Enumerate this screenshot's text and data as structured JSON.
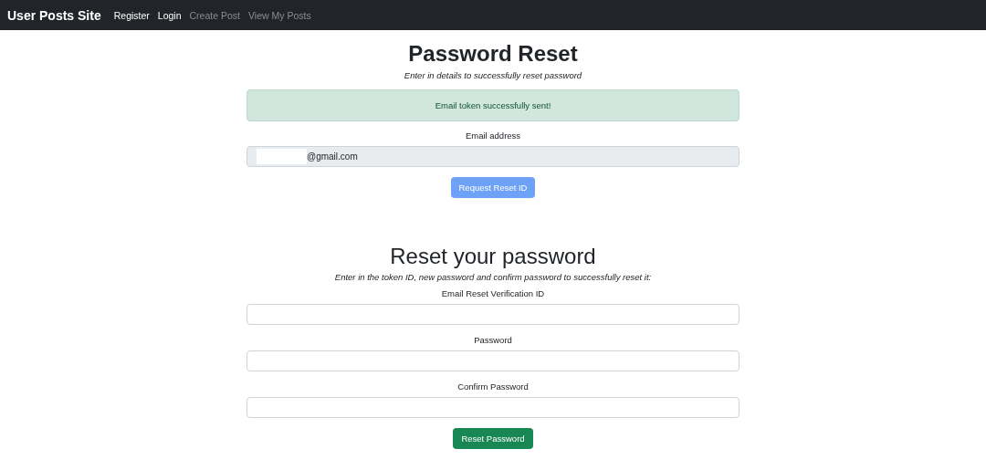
{
  "navbar": {
    "brand": "User Posts Site",
    "links": [
      {
        "label": "Register",
        "disabled": false
      },
      {
        "label": "Login",
        "disabled": false
      },
      {
        "label": "Create Post",
        "disabled": true
      },
      {
        "label": "View My Posts",
        "disabled": true
      }
    ]
  },
  "request_section": {
    "title": "Password Reset",
    "subtitle": "Enter in details to successfully reset password",
    "alert": "Email token successfully sent!",
    "email_label": "Email address",
    "email_value": "@gmail.com",
    "email_redacted": true,
    "button": {
      "label": "Request Reset ID",
      "disabled": true
    }
  },
  "reset_section": {
    "title": "Reset your password",
    "subtitle": "Enter in the token ID, new password and confirm password to successfully reset it:",
    "fields": [
      {
        "label": "Email Reset Verification ID"
      },
      {
        "label": "Password"
      },
      {
        "label": "Confirm Password"
      }
    ],
    "button": {
      "label": "Reset Password",
      "disabled": false
    }
  }
}
